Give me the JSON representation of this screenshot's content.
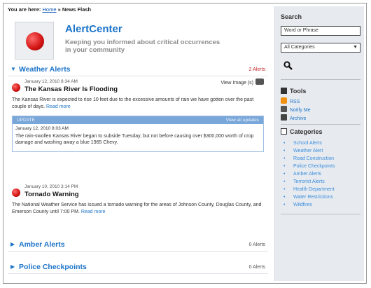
{
  "breadcrumb": {
    "prefix": "You are here:",
    "home": "Home",
    "separator": "»",
    "current": "News Flash"
  },
  "brand": {
    "title": "AlertCenter",
    "tagline": "Keeping you informed about critical occurrences in your community"
  },
  "sections": {
    "weather": {
      "name": "Weather Alerts",
      "count": "2 Alerts",
      "expanded": true
    },
    "amber": {
      "name": "Amber Alerts",
      "count": "0 Alerts",
      "expanded": false
    },
    "police": {
      "name": "Police Checkpoints",
      "count": "0 Alerts",
      "expanded": false
    }
  },
  "alerts": [
    {
      "date": "January 12, 2010   8:34 AM",
      "headline": "The Kansas River Is Flooding",
      "view_image": "View Image (s)",
      "body": "The Kansas River is expected to rise 10 feet due to the excessive amounts of rain we have gotten over the past couple of days.",
      "read_more": "Read more",
      "update": {
        "label": "UPDATE",
        "right": "View all updates",
        "date": "January 12, 2010   8:03 AM",
        "text": "The rain-swollen Kansas River began to subside Tuesday, but not before causing over $300,000 worth of crop damage and washing away a blue 1965 Chevy."
      }
    },
    {
      "date": "January 10, 2010   3:14 PM",
      "headline": "Tornado Warning",
      "body": "The National Weather Service has issued a tornado warning for the areas of Johnson County, Douglas County, and Emerson County until 7:00 PM.",
      "read_more": "Read more"
    }
  ],
  "sidebar": {
    "search_title": "Search",
    "search_placeholder": "Word or Phrase",
    "category_selected": "All Categories",
    "tools_title": "Tools",
    "tools": [
      "RSS",
      "Notify Me",
      "Archive"
    ],
    "categories_title": "Categories",
    "categories": [
      "School Alerts",
      "Weather Alert",
      "Road Construction",
      "Police Checkpoints",
      "Amber Alerts",
      "Terrorist Alerts",
      "Health Department",
      "Water Restrictions",
      "Wildfires"
    ]
  },
  "colors": {
    "accent": "#1c74c9",
    "alert_red": "#d11212",
    "sidebar_bg": "#e7ebf0",
    "update_bar": "#7aa7d9"
  },
  "icons": {
    "search": "magnifier-icon",
    "rss": "rss-icon",
    "notify": "notify-icon",
    "archive": "archive-icon",
    "camera": "camera-icon"
  }
}
